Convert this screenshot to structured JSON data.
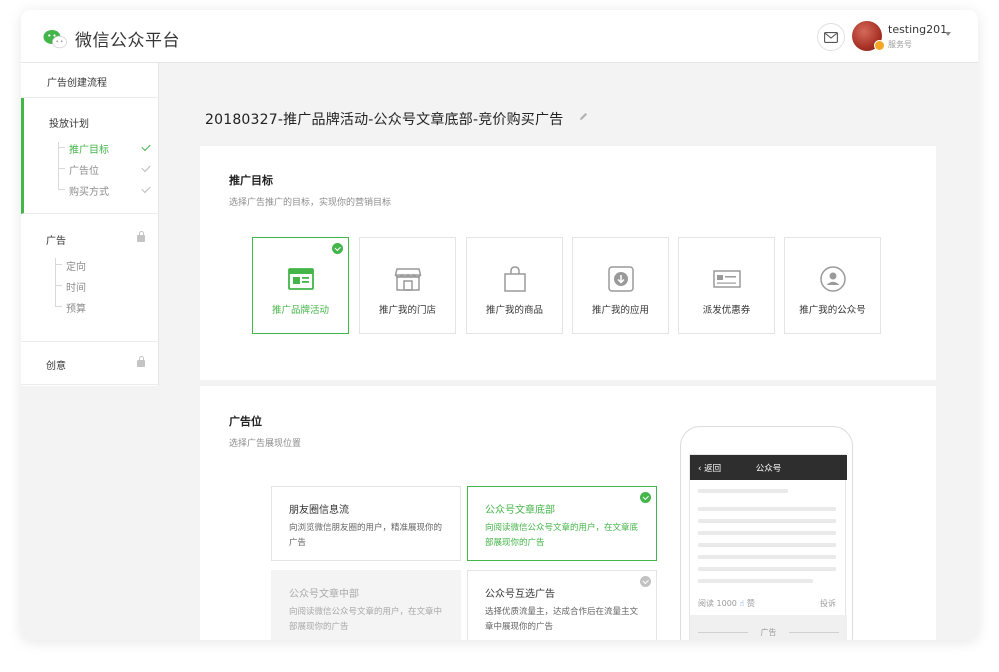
{
  "app": {
    "name": "微信公众平台",
    "account": {
      "username": "testing201",
      "type": "服务号"
    }
  },
  "sidebar": {
    "header": "广告创建流程",
    "groups": [
      {
        "title": "投放计划",
        "active": true,
        "items": [
          {
            "label": "推广目标",
            "state": "current"
          },
          {
            "label": "广告位",
            "state": "done"
          },
          {
            "label": "购买方式",
            "state": "done"
          }
        ]
      },
      {
        "title": "广告",
        "locked": true,
        "items": [
          {
            "label": "定向"
          },
          {
            "label": "时间"
          },
          {
            "label": "预算"
          }
        ]
      },
      {
        "title": "创意",
        "locked": true,
        "items": []
      }
    ]
  },
  "page": {
    "title": "20180327-推广品牌活动-公众号文章底部-竞价购买广告"
  },
  "objective": {
    "title": "推广目标",
    "subtitle": "选择广告推广的目标，实现你的营销目标",
    "options": [
      {
        "label": "推广品牌活动",
        "icon": "browser-window-icon",
        "selected": true
      },
      {
        "label": "推广我的门店",
        "icon": "storefront-icon"
      },
      {
        "label": "推广我的商品",
        "icon": "shopping-bag-icon"
      },
      {
        "label": "推广我的应用",
        "icon": "download-app-icon"
      },
      {
        "label": "派发优惠券",
        "icon": "coupon-icon"
      },
      {
        "label": "推广我的公众号",
        "icon": "user-circle-icon"
      }
    ]
  },
  "placement": {
    "title": "广告位",
    "subtitle": "选择广告展现位置",
    "options": [
      {
        "title": "朋友圈信息流",
        "desc": "向浏览微信朋友圈的用户，精准展现你的广告",
        "state": "normal"
      },
      {
        "title": "公众号文章底部",
        "desc": "向阅读微信公众号文章的用户，在文章底部展现你的广告",
        "state": "selected"
      },
      {
        "title": "公众号文章中部",
        "desc": "向阅读微信公众号文章的用户，在文章中部展现你的广告",
        "state": "disabled"
      },
      {
        "title": "公众号互选广告",
        "desc": "选择优质流量主，达成合作后在流量主文章中展现你的广告",
        "state": "normal-check"
      }
    ],
    "preview": {
      "back": "返回",
      "nav_title": "公众号",
      "read_count": "阅读 1000",
      "like": "赞",
      "report": "投诉",
      "ad_label": "广告"
    }
  },
  "colors": {
    "accent": "#44b549",
    "text": "#353535",
    "muted": "#8d8d8d",
    "bg": "#f3f3f4"
  }
}
